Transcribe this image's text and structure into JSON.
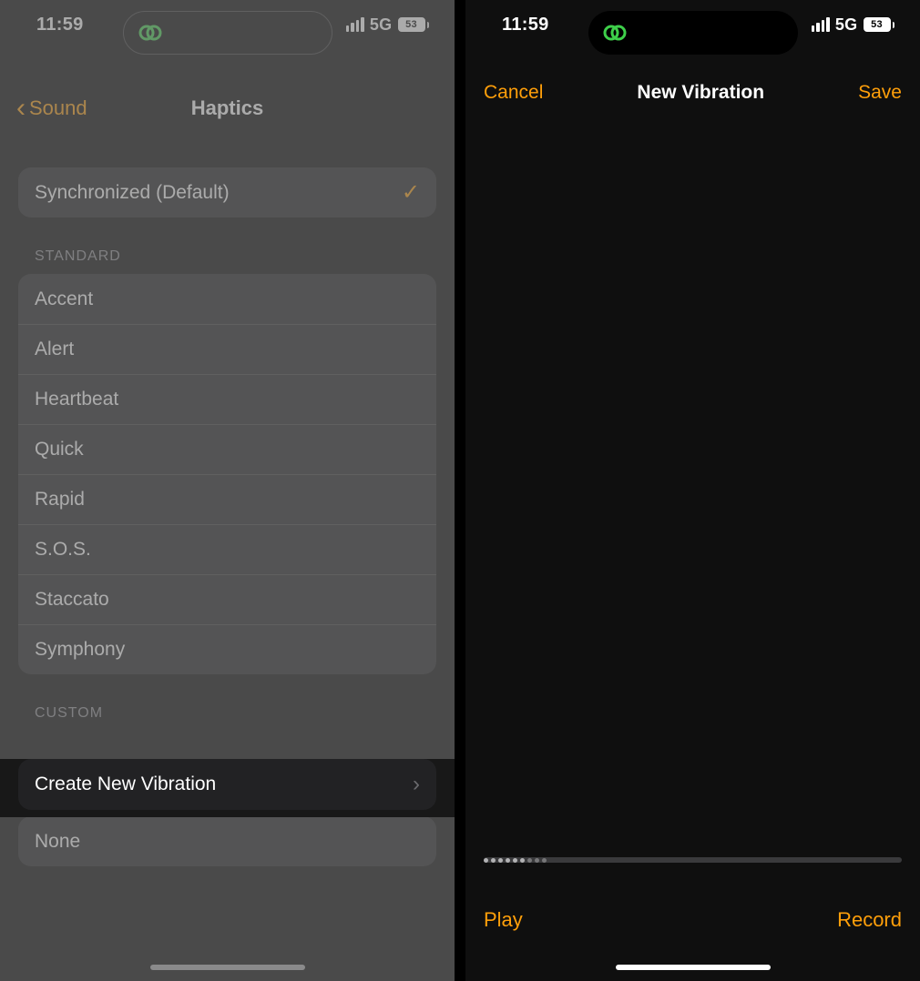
{
  "status": {
    "time": "11:59",
    "network": "5G",
    "battery": "53"
  },
  "left": {
    "back": "Sound",
    "title": "Haptics",
    "defaultItem": "Synchronized (Default)",
    "standardHeader": "STANDARD",
    "standardItems": [
      "Accent",
      "Alert",
      "Heartbeat",
      "Quick",
      "Rapid",
      "S.O.S.",
      "Staccato",
      "Symphony"
    ],
    "customHeader": "CUSTOM",
    "createNew": "Create New Vibration",
    "none": "None"
  },
  "right": {
    "cancel": "Cancel",
    "title": "New Vibration",
    "save": "Save",
    "play": "Play",
    "record": "Record"
  }
}
